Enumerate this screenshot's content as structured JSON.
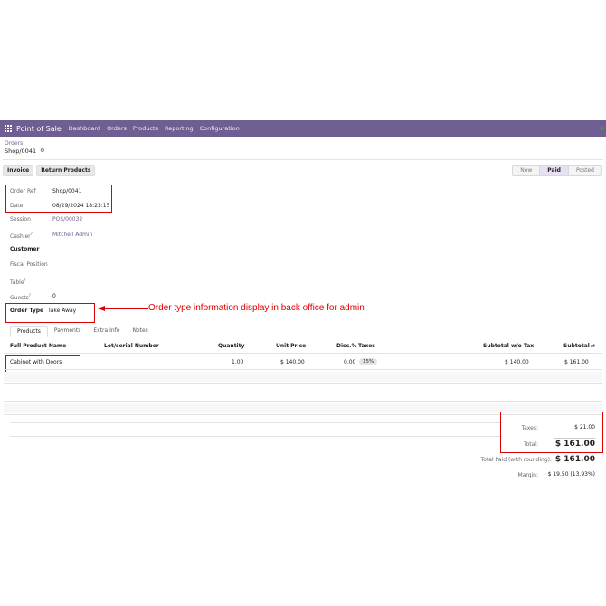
{
  "navbar": {
    "brand": "Point of Sale",
    "items": [
      "Dashboard",
      "Orders",
      "Products",
      "Reporting",
      "Configuration"
    ]
  },
  "breadcrumb": {
    "parent": "Orders",
    "current": "Shop/0041"
  },
  "toolbar": {
    "invoice": "Invoice",
    "return_products": "Return Products"
  },
  "status": [
    "New",
    "Paid",
    "Posted"
  ],
  "fields": {
    "order_ref": {
      "label": "Order Ref",
      "value": "Shop/0041"
    },
    "date": {
      "label": "Date",
      "value": "08/29/2024 18:23:15"
    },
    "session": {
      "label": "Session",
      "value": "POS/00032"
    },
    "cashier": {
      "label": "Cashier",
      "value": "Mitchell Admin"
    },
    "customer": {
      "label": "Customer"
    },
    "fiscal_position": {
      "label": "Fiscal Position"
    },
    "table": {
      "label": "Table"
    },
    "guests": {
      "label": "Guests",
      "value": "0"
    },
    "order_type": {
      "label": "Order Type",
      "value": "Take Away"
    },
    "help_mark": "?"
  },
  "annotation": "Order type information display in back office for admin",
  "tabs": [
    "Products",
    "Payments",
    "Extra Info",
    "Notes"
  ],
  "table": {
    "headers": {
      "product": "Full Product Name",
      "lot": "Lot/serial Number",
      "qty": "Quantity",
      "price": "Unit Price",
      "disc": "Disc.%",
      "taxes": "Taxes",
      "subtotal_wo": "Subtotal w/o Tax",
      "subtotal": "Subtotal",
      "settings_icon": "⇄"
    },
    "rows": [
      {
        "product": "Cabinet with Doors",
        "qty": "1.00",
        "price": "$ 140.00",
        "disc": "0.00",
        "tax": "15%",
        "subtotal_wo": "$ 140.00",
        "subtotal": "$ 161.00"
      }
    ]
  },
  "totals": {
    "taxes_label": "Taxes:",
    "taxes_value": "$ 21.00",
    "total_label": "Total:",
    "total_value": "$ 161.00",
    "paid_label": "Total Paid (with rounding):",
    "paid_value": "$ 161.00",
    "margin_label": "Margin:",
    "margin_value": "$ 19.50 (13.93%)"
  },
  "colors": {
    "navbar": "#6f5e92",
    "annotation": "#e00000",
    "online": "#28a745"
  }
}
